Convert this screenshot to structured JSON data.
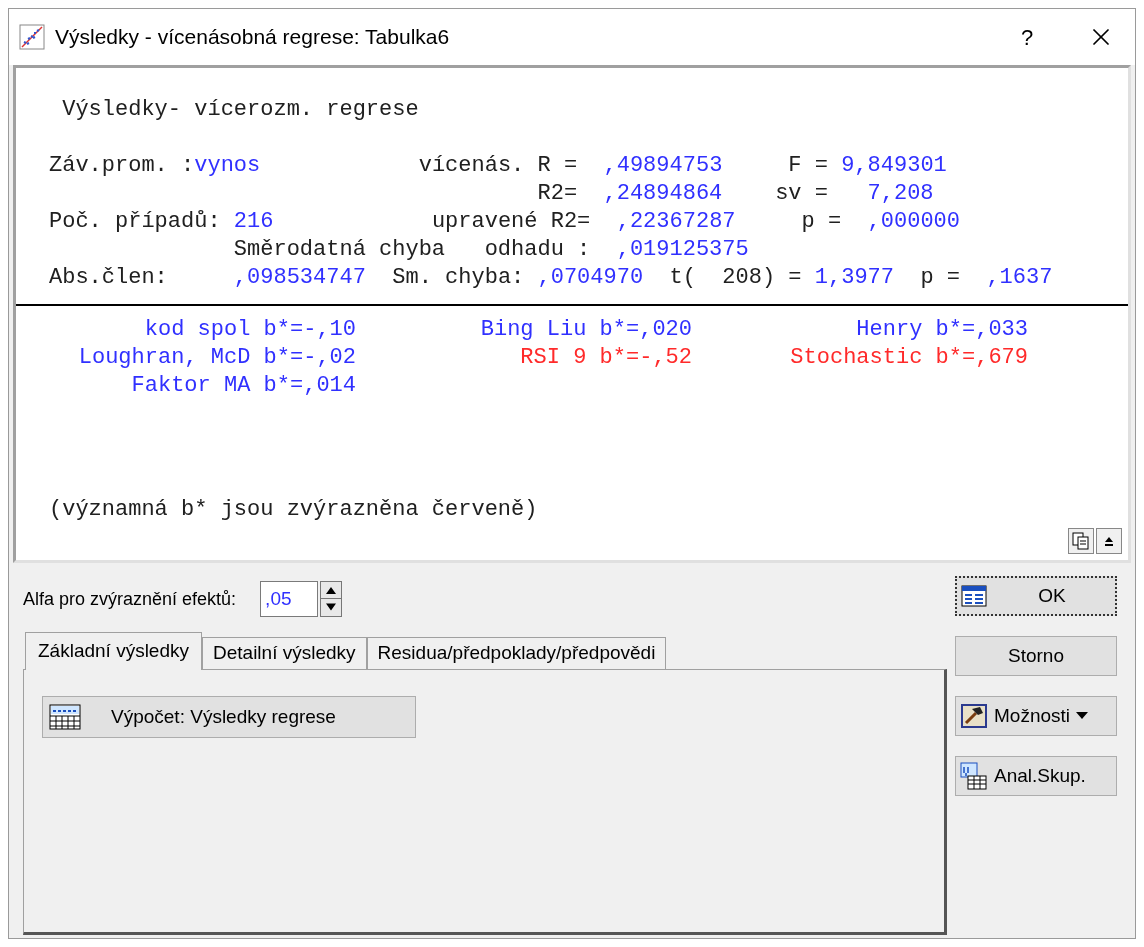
{
  "window": {
    "title": "Výsledky - vícenásobná regrese: Tabulka6",
    "help": "?"
  },
  "output": {
    "summary_lines": [
      [
        {
          "text": " Výsledky- vícerozm. regrese",
          "kind": "label"
        }
      ],
      [
        {
          "text": "Záv.prom. :",
          "kind": "label"
        },
        {
          "text": "vynos",
          "kind": "value"
        },
        {
          "text": "            vícenás. R =  ",
          "kind": "label"
        },
        {
          "text": ",49894753",
          "kind": "value"
        },
        {
          "text": "     F = ",
          "kind": "label"
        },
        {
          "text": "9,849301",
          "kind": "value"
        }
      ],
      [
        {
          "text": "                                     R2=  ",
          "kind": "label"
        },
        {
          "text": ",24894864",
          "kind": "value"
        },
        {
          "text": "    sv =   ",
          "kind": "label"
        },
        {
          "text": "7,208",
          "kind": "value"
        }
      ],
      [
        {
          "text": "Poč. případů: ",
          "kind": "label"
        },
        {
          "text": "216",
          "kind": "value"
        },
        {
          "text": "            upravené R2=  ",
          "kind": "label"
        },
        {
          "text": ",22367287",
          "kind": "value"
        },
        {
          "text": "     p =  ",
          "kind": "label"
        },
        {
          "text": ",000000",
          "kind": "value"
        }
      ],
      [
        {
          "text": "              Směrodatná chyba   odhadu :  ",
          "kind": "label"
        },
        {
          "text": ",019125375",
          "kind": "value"
        }
      ],
      [
        {
          "text": "Abs.člen:     ",
          "kind": "label"
        },
        {
          "text": ",098534747",
          "kind": "value"
        },
        {
          "text": "  Sm. chyba: ",
          "kind": "label"
        },
        {
          "text": ",0704970",
          "kind": "value"
        },
        {
          "text": "  t(  208) = ",
          "kind": "label"
        },
        {
          "text": "1,3977",
          "kind": "value"
        },
        {
          "text": "  p =  ",
          "kind": "label"
        },
        {
          "text": ",1637",
          "kind": "value"
        }
      ]
    ],
    "coefficients": [
      {
        "text": "kod spol b*=-,10",
        "significant": false
      },
      {
        "text": "Bing Liu b*=,020",
        "significant": false
      },
      {
        "text": "Henry b*=,033",
        "significant": false
      },
      {
        "text": "Loughran, McD b*=-,02",
        "significant": false
      },
      {
        "text": "RSI 9 b*=-,52",
        "significant": true
      },
      {
        "text": "Stochastic b*=,679",
        "significant": true
      },
      {
        "text": "Faktor MA b*=,014",
        "significant": false
      }
    ],
    "note": "(významná b* jsou zvýrazněna červeně)"
  },
  "alpha": {
    "label": "Alfa pro zvýraznění efektů:",
    "value": ",05"
  },
  "tabs": [
    {
      "label": "Základní výsledky",
      "selected": true
    },
    {
      "label": "Detailní výsledky",
      "selected": false
    },
    {
      "label": "Residua/předpoklady/předpovědi",
      "selected": false
    }
  ],
  "action": {
    "label": "Výpočet:  Výsledky regrese"
  },
  "buttons": [
    {
      "label": "OK",
      "kind": "ok",
      "focused": true
    },
    {
      "label": "Storno",
      "kind": "plain",
      "focused": false
    },
    {
      "label": "Možnosti",
      "kind": "menu",
      "focused": false
    },
    {
      "label": "Anal.Skup.",
      "kind": "group",
      "focused": false
    }
  ]
}
